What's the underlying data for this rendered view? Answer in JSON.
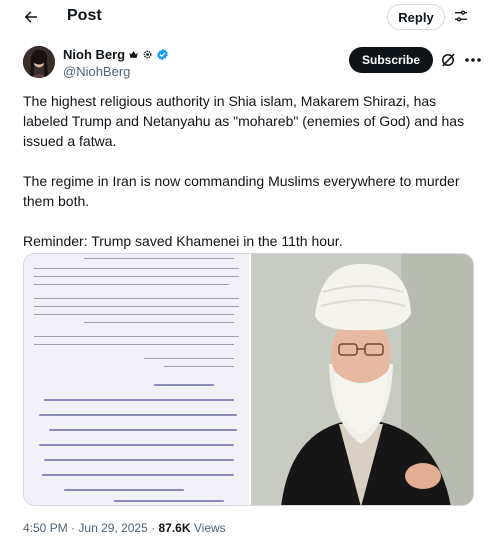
{
  "header": {
    "title": "Post",
    "reply_label": "Reply"
  },
  "author": {
    "name": "Nioh Berg",
    "handle": "@NiohBerg",
    "badges": [
      "crown-icon",
      "gear-badge-icon",
      "verified-icon"
    ],
    "subscribe_label": "Subscribe"
  },
  "tweet": {
    "paragraphs": [
      "The highest religious authority in Shia islam, Makarem Shirazi, has labeled Trump and Netanyahu as \"mohareb\" (enemies of God) and has issued a fatwa.",
      "The regime in Iran is now commanding Muslims everywhere to murder them both.",
      "Reminder: Trump saved Khamenei in the 11th hour."
    ]
  },
  "media": {
    "left": "scanned-letter-with-persian-handwriting",
    "right": "photo-of-cleric-in-white-turban"
  },
  "meta": {
    "time": "4:50 PM",
    "separator": "·",
    "date": "Jun 29, 2025",
    "views_count": "87.6K",
    "views_label": "Views"
  },
  "colors": {
    "text": "#0f1419",
    "secondary": "#536471",
    "border": "#cfd9de",
    "verified": "#1d9bf0"
  }
}
